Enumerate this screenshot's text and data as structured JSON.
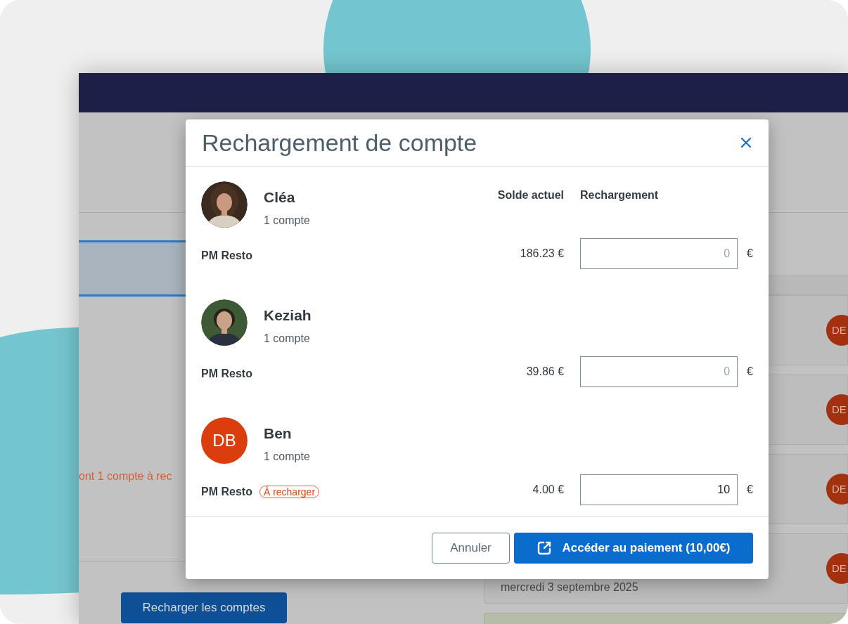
{
  "background": {
    "notice": "ont 1 compte à rec",
    "recharge_button": "Recharger les comptes",
    "date": "mercredi 3 septembre 2025",
    "badges": [
      "DE",
      "DE",
      "DE",
      "DE"
    ]
  },
  "modal": {
    "title": "Rechargement de compte",
    "columns": [
      "Solde actuel",
      "Rechargement"
    ],
    "members": [
      {
        "name": "Cléa",
        "accounts": "1 compte",
        "account": {
          "label": "PM Resto",
          "balance": "186.23 €",
          "placeholder": "0",
          "currency": "€"
        }
      },
      {
        "name": "Keziah",
        "accounts": "1 compte",
        "account": {
          "label": "PM Resto",
          "balance": "39.86 €",
          "placeholder": "0",
          "currency": "€"
        }
      },
      {
        "name": "Ben",
        "accounts": "1 compte",
        "avatar": {
          "kind": "initials",
          "initials": "DB"
        },
        "account": {
          "label": "PM Resto",
          "badge": "À recharger",
          "balance": "4.00 €",
          "value": "10",
          "currency": "€"
        }
      }
    ],
    "buttons": {
      "cancel": "Annuler",
      "pay": "Accéder au paiement (10,00€)"
    }
  }
}
